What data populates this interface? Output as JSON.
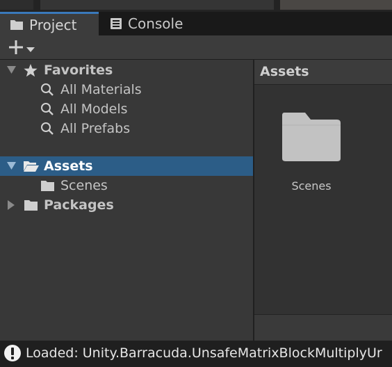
{
  "tabs": [
    {
      "label": "Project",
      "icon": "folder-icon",
      "active": true
    },
    {
      "label": "Console",
      "icon": "console-icon",
      "active": false
    }
  ],
  "toolbar": {
    "add_icon": "plus-icon",
    "dropdown_icon": "chevron-down-icon"
  },
  "tree": {
    "favorites": {
      "label": "Favorites",
      "items": [
        "All Materials",
        "All Models",
        "All Prefabs"
      ]
    },
    "assets": {
      "label": "Assets",
      "children": [
        "Scenes"
      ]
    },
    "packages": {
      "label": "Packages"
    }
  },
  "content": {
    "breadcrumb": "Assets",
    "items": [
      {
        "label": "Scenes",
        "icon": "folder-icon"
      }
    ]
  },
  "status": {
    "message": "Loaded: Unity.Barracuda.UnsafeMatrixBlockMultiplyUr",
    "icon": "warning-icon"
  },
  "colors": {
    "selection": "#2c5d87",
    "tab_accent": "#3a79bb",
    "background": "#383838"
  }
}
